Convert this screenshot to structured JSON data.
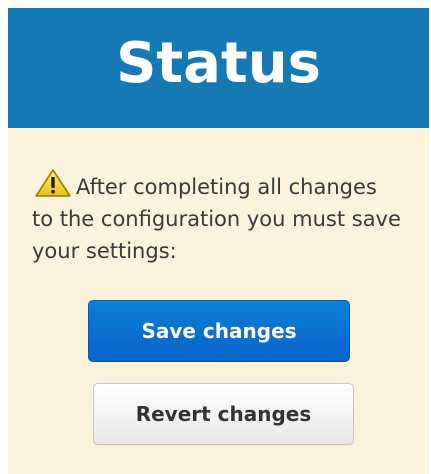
{
  "panel": {
    "title": "Status",
    "colors": {
      "header_bg": "#1479b5",
      "body_bg": "#fbf3dc",
      "primary_button": "#0a74d4"
    }
  },
  "notice": {
    "icon": "warning-triangle-icon",
    "text": "After completing all changes to the configuration you must save your settings:"
  },
  "buttons": {
    "save_label": "Save changes",
    "revert_label": "Revert changes"
  }
}
